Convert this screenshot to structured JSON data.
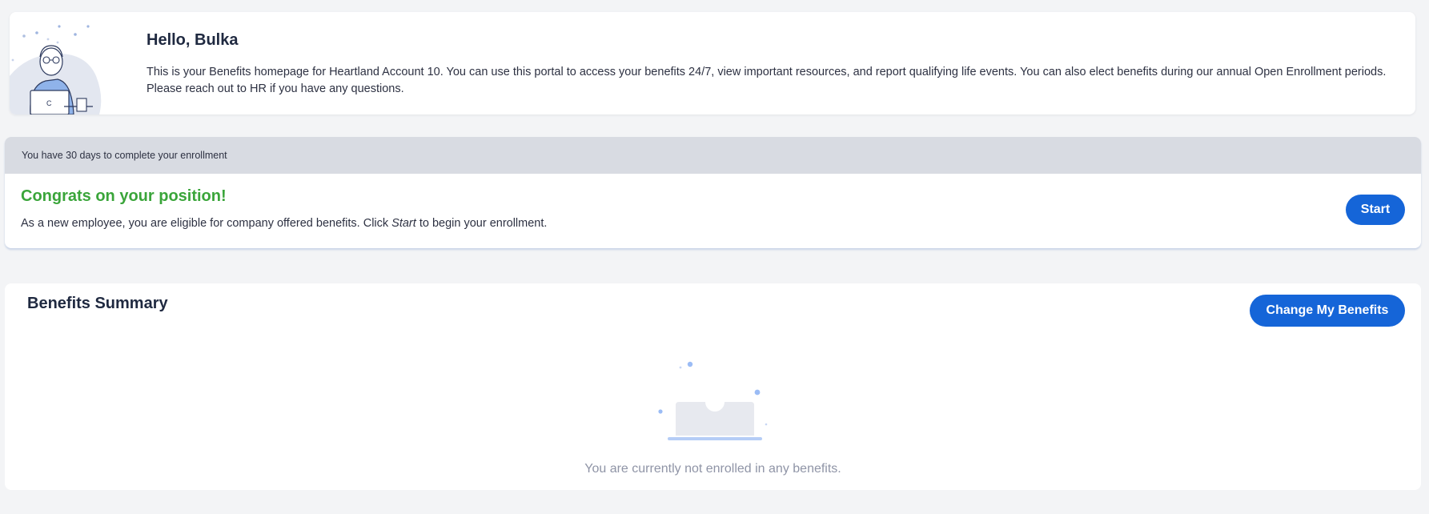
{
  "welcome": {
    "greeting": "Hello, Bulka",
    "intro": "This is your Benefits homepage for Heartland Account 10. You can use this portal to access your benefits 24/7, view important resources, and report qualifying life events. You can also elect benefits during our annual Open Enrollment periods. Please reach out to HR if you have any questions.",
    "illustration_icon": "person-at-laptop-illustration",
    "laptop_letter": "C"
  },
  "enrollment": {
    "banner_text": "You have 30 days to complete your enrollment",
    "heading": "Congrats on your position!",
    "desc_before": "As a new employee, you are eligible for company offered benefits. Click ",
    "desc_em": "Start",
    "desc_after": " to begin your enrollment.",
    "start_label": "Start"
  },
  "summary": {
    "title": "Benefits Summary",
    "change_label": "Change My Benefits",
    "empty_icon": "empty-box-illustration",
    "empty_text": "You are currently not enrolled in any benefits."
  },
  "colors": {
    "page_bg": "#f3f4f6",
    "primary": "#1565d8",
    "success": "#3aa53a",
    "banner_bg": "#d8dbe2"
  }
}
